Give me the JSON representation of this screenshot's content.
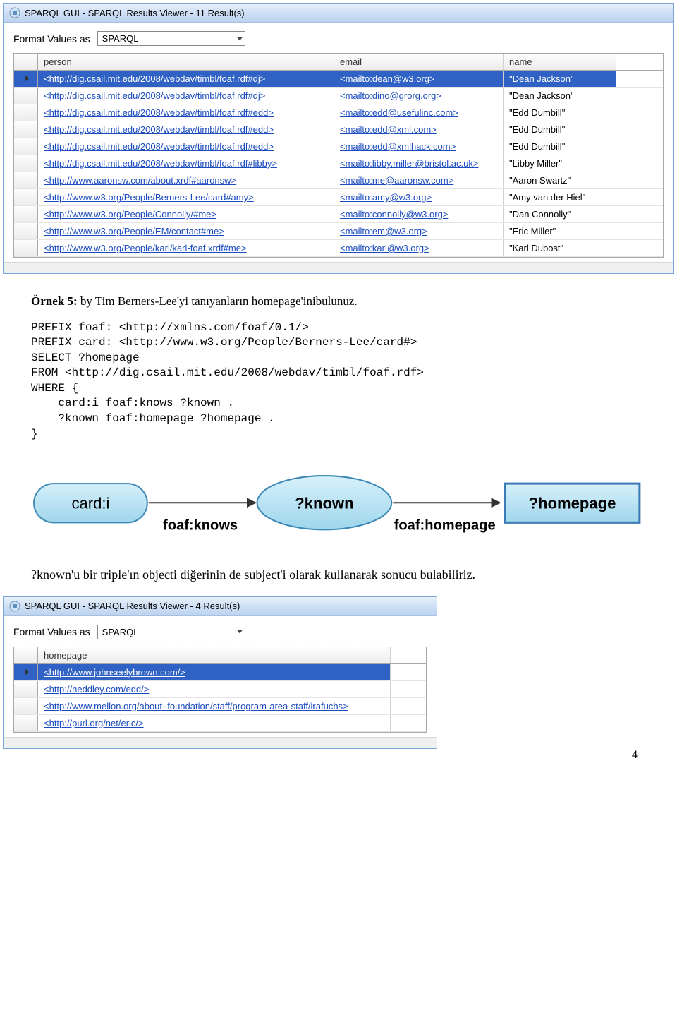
{
  "window1": {
    "title": "SPARQL GUI - SPARQL Results Viewer - 11 Result(s)",
    "format_label": "Format Values as",
    "format_value": "SPARQL",
    "columns": {
      "person": "person",
      "email": "email",
      "name": "name"
    },
    "rows": [
      {
        "person": "<http://dig.csail.mit.edu/2008/webdav/timbl/foaf.rdf#dj>",
        "email": "<mailto:dean@w3.org>",
        "name": "\"Dean Jackson\""
      },
      {
        "person": "<http://dig.csail.mit.edu/2008/webdav/timbl/foaf.rdf#dj>",
        "email": "<mailto:dino@grorg.org>",
        "name": "\"Dean Jackson\""
      },
      {
        "person": "<http://dig.csail.mit.edu/2008/webdav/timbl/foaf.rdf#edd>",
        "email": "<mailto:edd@usefulinc.com>",
        "name": "\"Edd Dumbill\""
      },
      {
        "person": "<http://dig.csail.mit.edu/2008/webdav/timbl/foaf.rdf#edd>",
        "email": "<mailto:edd@xml.com>",
        "name": "\"Edd Dumbill\""
      },
      {
        "person": "<http://dig.csail.mit.edu/2008/webdav/timbl/foaf.rdf#edd>",
        "email": "<mailto:edd@xmlhack.com>",
        "name": "\"Edd Dumbill\""
      },
      {
        "person": "<http://dig.csail.mit.edu/2008/webdav/timbl/foaf.rdf#libby>",
        "email": "<mailto:libby.miller@bristol.ac.uk>",
        "name": "\"Libby Miller\""
      },
      {
        "person": "<http://www.aaronsw.com/about.xrdf#aaronsw>",
        "email": "<mailto:me@aaronsw.com>",
        "name": "\"Aaron Swartz\""
      },
      {
        "person": "<http://www.w3.org/People/Berners-Lee/card#amy>",
        "email": "<mailto:amy@w3.org>",
        "name": "\"Amy van der Hiel\""
      },
      {
        "person": "<http://www.w3.org/People/Connolly/#me>",
        "email": "<mailto:connolly@w3.org>",
        "name": "\"Dan Connolly\""
      },
      {
        "person": "<http://www.w3.org/People/EM/contact#me>",
        "email": "<mailto:em@w3.org>",
        "name": "\"Eric Miller\""
      },
      {
        "person": "<http://www.w3.org/People/karl/karl-foaf.xrdf#me>",
        "email": "<mailto:karl@w3.org>",
        "name": "\"Karl Dubost\""
      }
    ]
  },
  "text": {
    "example_bold": "Örnek 5:",
    "example_rest": " by Tim Berners-Lee'yi tanıyanların homepage'inibulunuz.",
    "query": "PREFIX foaf: <http://xmlns.com/foaf/0.1/>\nPREFIX card: <http://www.w3.org/People/Berners-Lee/card#>\nSELECT ?homepage\nFROM <http://dig.csail.mit.edu/2008/webdav/timbl/foaf.rdf>\nWHERE {\n    card:i foaf:knows ?known .\n    ?known foaf:homepage ?homepage .\n}",
    "paragraph": "?known'u bir triple'ın objecti diğerinin de subject'i olarak kullanarak sonucu bulabiliriz.",
    "page_num": "4"
  },
  "diagram": {
    "node1": "card:i",
    "edge1": "foaf:knows",
    "node2": "?known",
    "edge2": "foaf:homepage",
    "node3": "?homepage"
  },
  "window2": {
    "title": "SPARQL GUI - SPARQL Results Viewer - 4 Result(s)",
    "format_label": "Format Values as",
    "format_value": "SPARQL",
    "columns": {
      "home": "homepage"
    },
    "rows": [
      {
        "home": "<http://www.johnseelybrown.com/>"
      },
      {
        "home": "<http://heddley.com/edd/>"
      },
      {
        "home": "<http://www.mellon.org/about_foundation/staff/program-area-staff/irafuchs>"
      },
      {
        "home": "<http://purl.org/net/eric/>"
      }
    ]
  }
}
